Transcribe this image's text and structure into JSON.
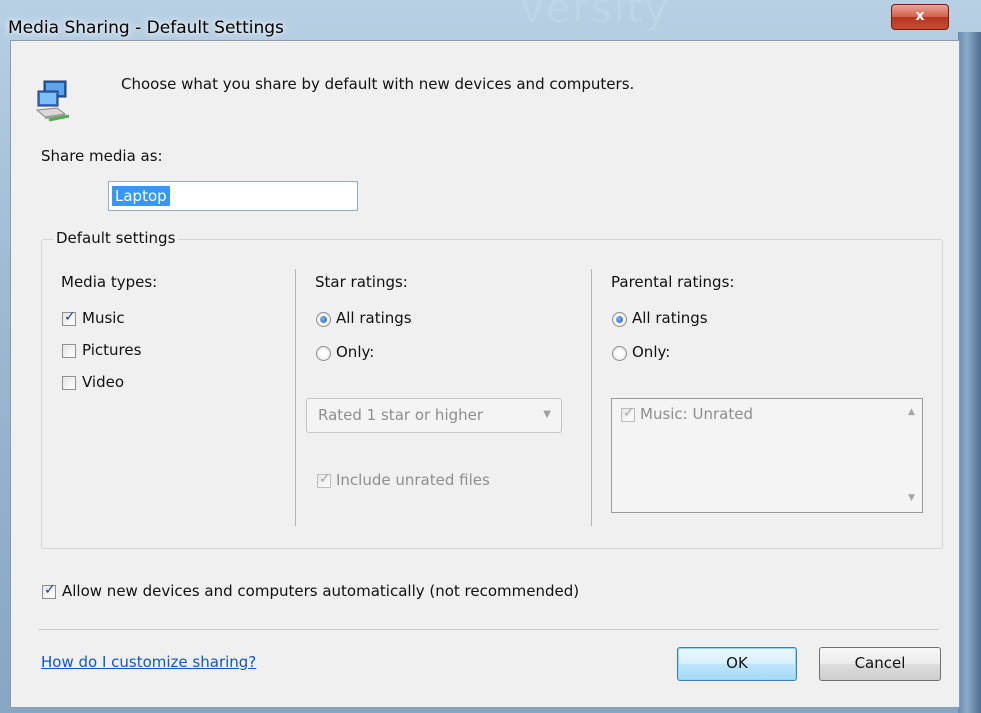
{
  "window": {
    "title": "Media Sharing - Default Settings",
    "background_text": "versity",
    "close_label": "x"
  },
  "header": {
    "icon": "network-computers-icon",
    "text": "Choose what you share by default with new devices and computers."
  },
  "share_media": {
    "label": "Share media as:",
    "value": "Laptop"
  },
  "default_settings": {
    "group_label": "Default settings",
    "media_types": {
      "label": "Media types:",
      "items": [
        {
          "label": "Music",
          "checked": true
        },
        {
          "label": "Pictures",
          "checked": false
        },
        {
          "label": "Video",
          "checked": false
        }
      ]
    },
    "star_ratings": {
      "label": "Star ratings:",
      "all_label": "All ratings",
      "only_label": "Only:",
      "selected": "all",
      "dropdown_value": "Rated 1 star or higher",
      "include_unrated_label": "Include unrated files",
      "include_unrated_checked": true
    },
    "parental_ratings": {
      "label": "Parental ratings:",
      "all_label": "All ratings",
      "only_label": "Only:",
      "selected": "all",
      "list_items": [
        {
          "label": "Music: Unrated",
          "checked": true
        }
      ]
    }
  },
  "allow_new": {
    "label": "Allow new devices and computers automatically (not recommended)",
    "checked": true
  },
  "footer": {
    "help_link": "How do I customize sharing?",
    "ok_label": "OK",
    "cancel_label": "Cancel"
  },
  "colors": {
    "link": "#0b5bc2",
    "selection": "#3399ff",
    "close_button": "#c94a33"
  }
}
